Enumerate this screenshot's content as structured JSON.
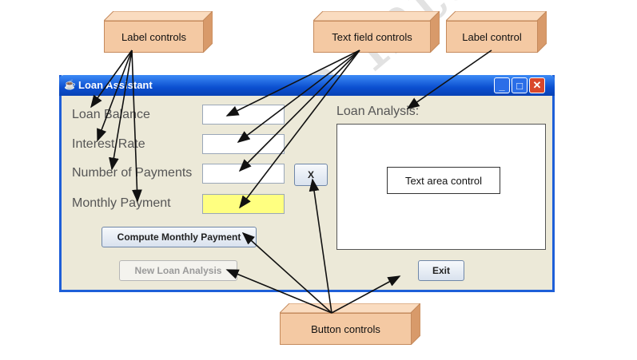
{
  "callouts": {
    "label_controls": "Label controls",
    "text_field_controls": "Text field controls",
    "label_control": "Label control",
    "button_controls": "Button controls",
    "text_area_control": "Text area control"
  },
  "window": {
    "title": "Loan Assistant",
    "labels": {
      "loan_balance": "Loan Balance",
      "interest_rate": "Interest Rate",
      "number_of_payments": "Number of Payments",
      "monthly_payment": "Monthly Payment",
      "loan_analysis": "Loan Analysis:"
    },
    "buttons": {
      "compute": "Compute Monthly Payment",
      "new_analysis": "New Loan Analysis",
      "clear_x": "X",
      "exit": "Exit"
    },
    "fields": {
      "loan_balance": "",
      "interest_rate": "",
      "number_of_payments": "",
      "monthly_payment": ""
    }
  },
  "colors": {
    "callout_fill": "#f4c9a3",
    "monthly_payment_field": "#ffff80",
    "titlebar": "#0b4fd0"
  }
}
